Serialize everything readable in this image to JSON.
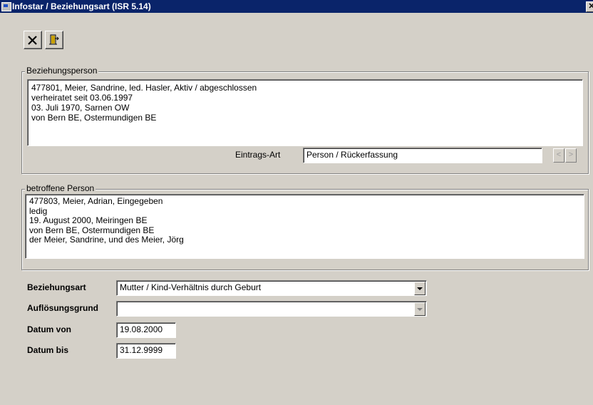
{
  "window": {
    "title": "Infostar / Beziehungsart (ISR 5.14)"
  },
  "toolbar": {
    "buttons": [
      {
        "icon": "close-x-icon"
      },
      {
        "icon": "exit-door-icon"
      }
    ]
  },
  "beziehungsperson": {
    "legend": "Beziehungsperson",
    "lines": [
      "477801, Meier, Sandrine, led. Hasler, Aktiv / abgeschlossen",
      "verheiratet seit 03.06.1997",
      "03. Juli 1970, Sarnen OW",
      "von Bern BE, Ostermundigen BE"
    ],
    "eintragsart_label": "Eintrags-Art",
    "eintragsart_value": "Person / Rückerfassung",
    "prev_glyph": "<",
    "next_glyph": ">"
  },
  "betroffene": {
    "legend": "betroffene Person",
    "lines": [
      "477803, Meier, Adrian, Eingegeben",
      "ledig",
      "19. August 2000, Meiringen BE",
      "von Bern BE, Ostermundigen BE",
      "der Meier, Sandrine, und des Meier, Jörg"
    ]
  },
  "form": {
    "beziehungsart_label": "Beziehungsart",
    "beziehungsart_value": "Mutter / Kind-Verhältnis durch Geburt",
    "aufloesungsgrund_label": "Auflösungsgrund",
    "aufloesungsgrund_value": "",
    "datum_von_label": "Datum von",
    "datum_von_value": "19.08.2000",
    "datum_bis_label": "Datum bis",
    "datum_bis_value": "31.12.9999"
  }
}
